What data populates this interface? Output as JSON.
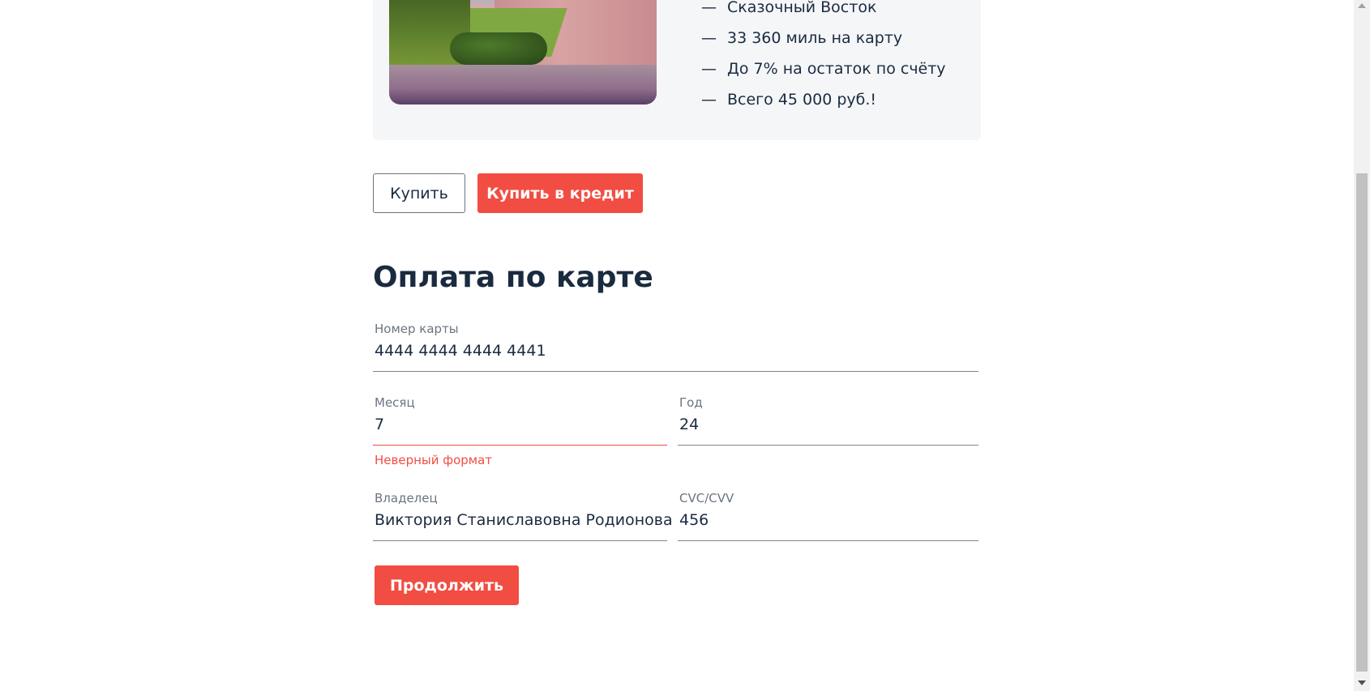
{
  "tour": {
    "image_alt": "tour-photo",
    "features": [
      {
        "dash": "—",
        "text": "Сказочный Восток"
      },
      {
        "dash": "—",
        "text": "33 360 миль на карту"
      },
      {
        "dash": "—",
        "text": "До 7% на остаток по счёту"
      },
      {
        "dash": "—",
        "text": "Всего 45 000 руб.!"
      }
    ]
  },
  "actions": {
    "buy_label": "Купить",
    "buy_credit_label": "Купить в кредит"
  },
  "payment": {
    "title": "Оплата по карте",
    "card_number": {
      "label": "Номер карты",
      "value": "4444 4444 4444 4441"
    },
    "month": {
      "label": "Месяц",
      "value": "7",
      "error": "Неверный формат"
    },
    "year": {
      "label": "Год",
      "value": "24"
    },
    "owner": {
      "label": "Владелец",
      "value": "Виктория Станиславовна Родионова"
    },
    "cvc": {
      "label": "CVC/CVV",
      "value": "456"
    },
    "continue_label": "Продолжить"
  },
  "colors": {
    "accent": "#f24d43",
    "text": "#1a2b40",
    "label": "#6b7480",
    "card_bg": "#f5f6f8"
  }
}
